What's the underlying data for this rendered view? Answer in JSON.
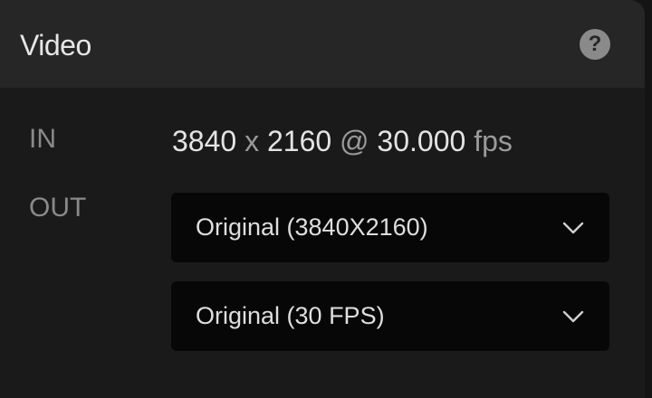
{
  "panel": {
    "title": "Video",
    "help_glyph": "?"
  },
  "input": {
    "label": "IN",
    "width": "3840",
    "times": "x",
    "height": "2160",
    "at": "@",
    "fps": "30.000",
    "fps_unit": "fps"
  },
  "output": {
    "label": "OUT",
    "resolution_select": {
      "value": "Original (3840X2160)"
    },
    "framerate_select": {
      "value": "Original (30 FPS)"
    }
  },
  "colors": {
    "panel_bg": "#1a1a1a",
    "header_bg": "#262626",
    "select_bg": "#070707",
    "label_gray": "#8a8a8a"
  },
  "icons": [
    "help-icon",
    "chevron-down-icon"
  ]
}
